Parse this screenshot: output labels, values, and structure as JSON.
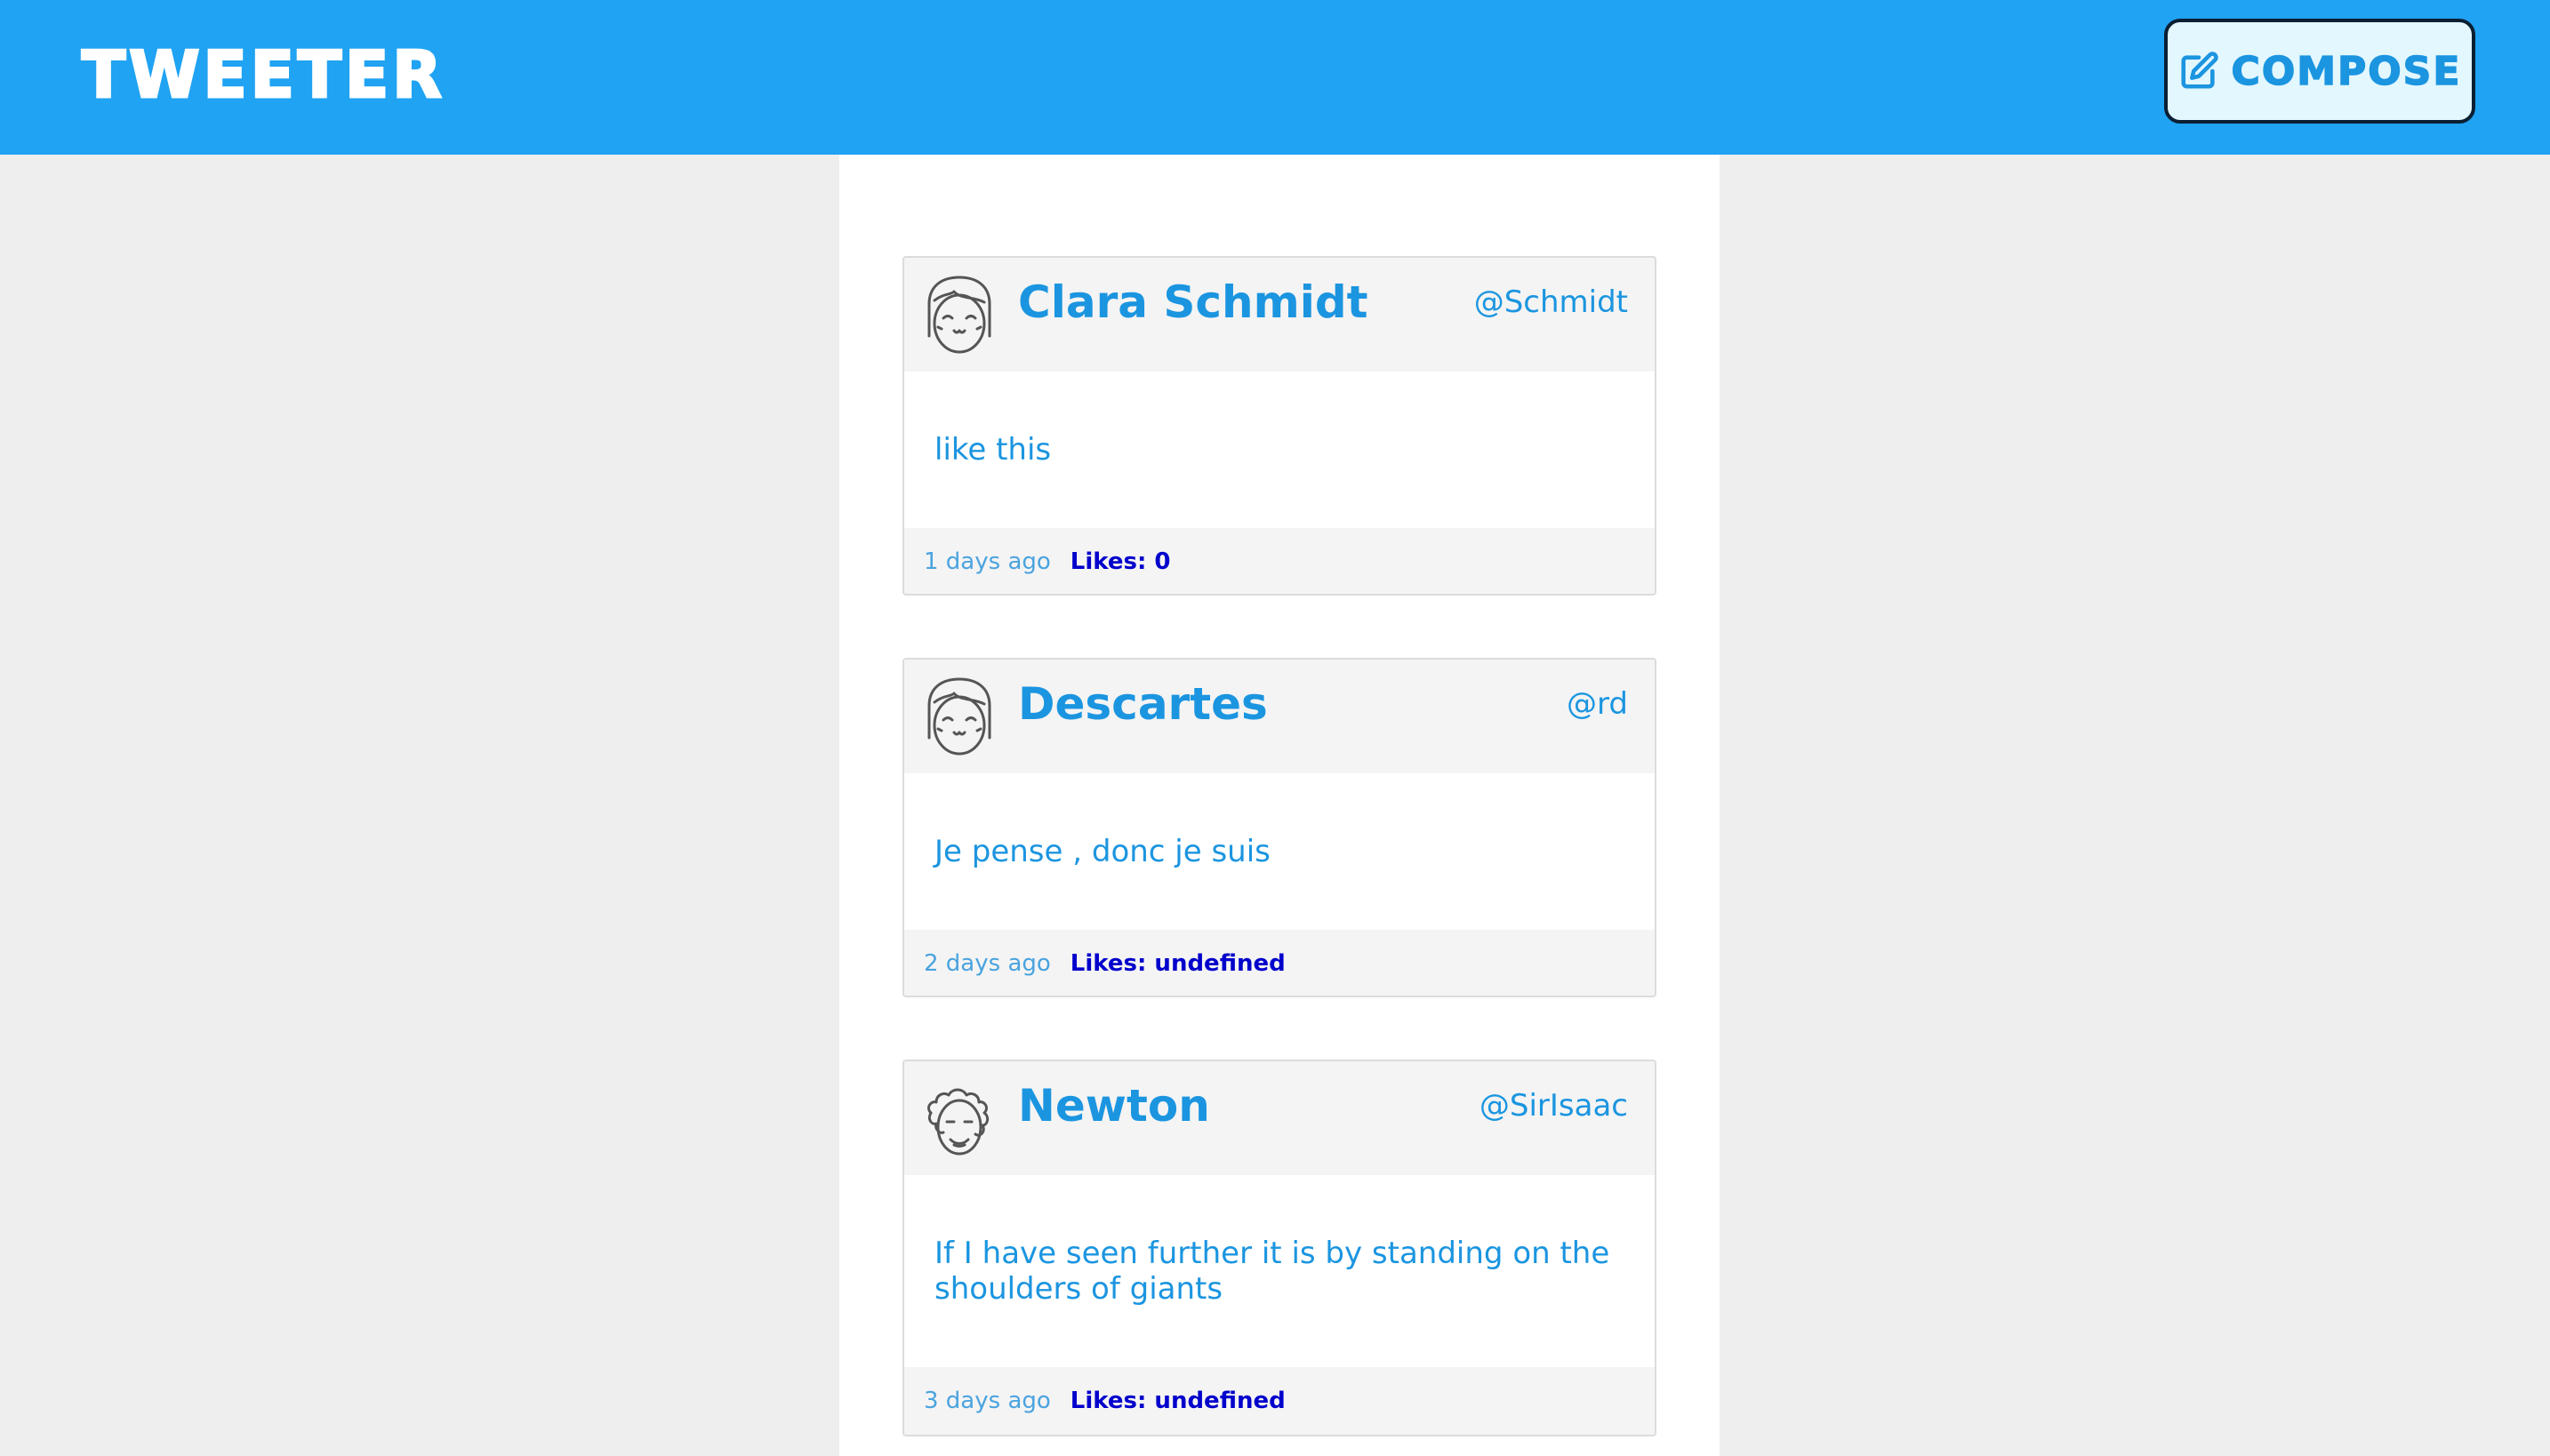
{
  "app": {
    "brand": "TWEETER",
    "compose_label": "COMPOSE"
  },
  "tweets": [
    {
      "name": "Clara Schmidt",
      "handle": "@Schmidt",
      "text": "like this",
      "time": "1 days ago",
      "likes": "Likes: 0",
      "avatar_icon": "girl-face-avatar-icon"
    },
    {
      "name": "Descartes",
      "handle": "@rd",
      "text": "Je pense , donc je suis",
      "time": "2 days ago",
      "likes": "Likes: undefined",
      "avatar_icon": "girl-face-avatar-icon"
    },
    {
      "name": "Newton",
      "handle": "@SirIsaac",
      "text": "If I have seen further it is by standing on the shoulders of giants",
      "time": "3 days ago",
      "likes": "Likes: undefined",
      "avatar_icon": "curly-hair-face-avatar-icon"
    }
  ],
  "colors": {
    "brand_blue": "#1fa3f2",
    "text_blue": "#1b95e0",
    "likes_blue": "#0000cc",
    "page_bg": "#eeeeee"
  }
}
